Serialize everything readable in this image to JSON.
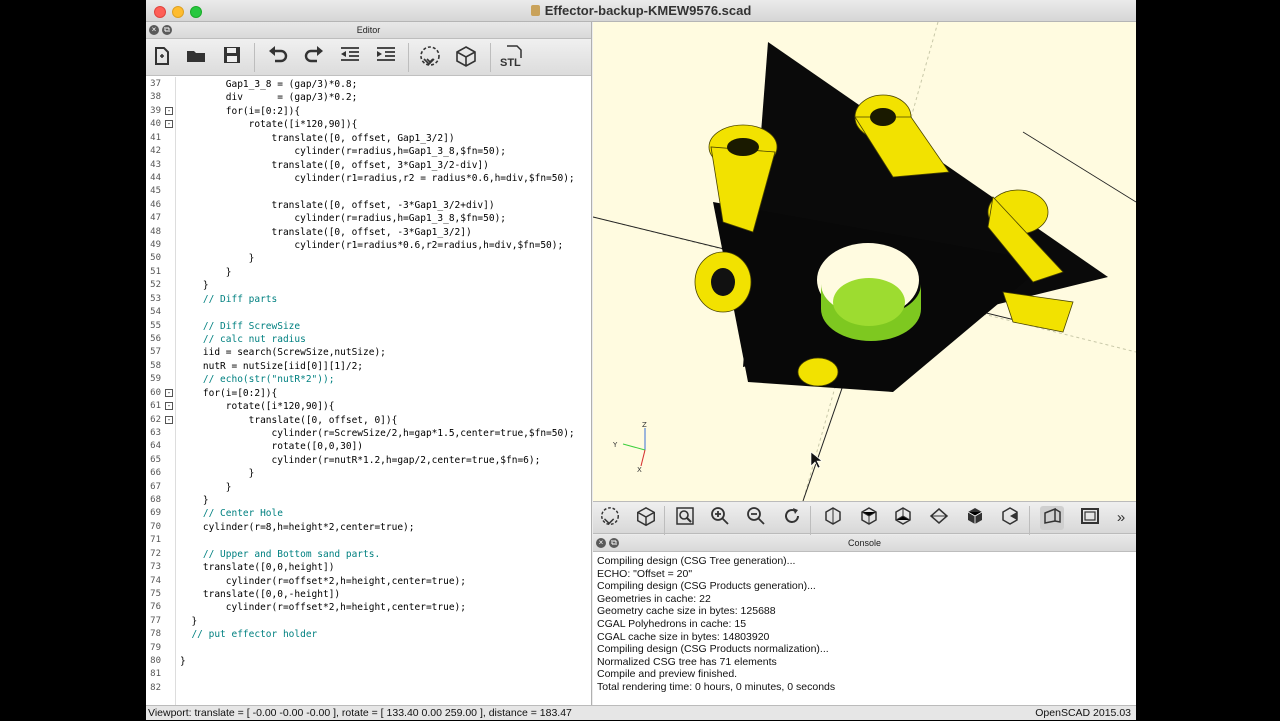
{
  "window": {
    "title": "Effector-backup-KMEW9576.scad"
  },
  "editor": {
    "header": "Editor",
    "toolbar": {
      "new": "new-file-icon",
      "open": "open-folder-icon",
      "save": "save-icon",
      "undo": "undo-icon",
      "redo": "redo-icon",
      "unindent": "unindent-icon",
      "indent": "indent-icon",
      "preview": "preview-icon",
      "render": "render-icon",
      "stl_label": "STL"
    },
    "lines": [
      {
        "n": "37",
        "fold": "",
        "text": "        Gap1_3_8 = (gap/3)*0.8;"
      },
      {
        "n": "38",
        "fold": "",
        "text": "        div      = (gap/3)*0.2;"
      },
      {
        "n": "39",
        "fold": "-",
        "text": "        for(i=[0:2]){"
      },
      {
        "n": "40",
        "fold": "-",
        "text": "            rotate([i*120,90]){"
      },
      {
        "n": "41",
        "fold": "",
        "text": "                translate([0, offset, Gap1_3/2])"
      },
      {
        "n": "42",
        "fold": "",
        "text": "                    cylinder(r=radius,h=Gap1_3_8,$fn=50);"
      },
      {
        "n": "43",
        "fold": "",
        "text": "                translate([0, offset, 3*Gap1_3/2-div])"
      },
      {
        "n": "44",
        "fold": "",
        "text": "                    cylinder(r1=radius,r2 = radius*0.6,h=div,$fn=50);"
      },
      {
        "n": "45",
        "fold": "",
        "text": ""
      },
      {
        "n": "46",
        "fold": "",
        "text": "                translate([0, offset, -3*Gap1_3/2+div])"
      },
      {
        "n": "47",
        "fold": "",
        "text": "                    cylinder(r=radius,h=Gap1_3_8,$fn=50);"
      },
      {
        "n": "48",
        "fold": "",
        "text": "                translate([0, offset, -3*Gap1_3/2])"
      },
      {
        "n": "49",
        "fold": "",
        "text": "                    cylinder(r1=radius*0.6,r2=radius,h=div,$fn=50);"
      },
      {
        "n": "50",
        "fold": "",
        "text": "            }"
      },
      {
        "n": "51",
        "fold": "",
        "text": "        }"
      },
      {
        "n": "52",
        "fold": "",
        "text": "    }"
      },
      {
        "n": "53",
        "fold": "",
        "text": "    // Diff parts"
      },
      {
        "n": "54",
        "fold": "",
        "text": ""
      },
      {
        "n": "55",
        "fold": "",
        "text": "    // Diff ScrewSize"
      },
      {
        "n": "56",
        "fold": "",
        "text": "    // calc nut radius"
      },
      {
        "n": "57",
        "fold": "",
        "text": "    iid = search(ScrewSize,nutSize);"
      },
      {
        "n": "58",
        "fold": "",
        "text": "    nutR = nutSize[iid[0]][1]/2;"
      },
      {
        "n": "59",
        "fold": "",
        "text": "    // echo(str(\"nutR*2\"));"
      },
      {
        "n": "60",
        "fold": "-",
        "text": "    for(i=[0:2]){"
      },
      {
        "n": "61",
        "fold": "-",
        "text": "        rotate([i*120,90]){"
      },
      {
        "n": "62",
        "fold": "-",
        "text": "            translate([0, offset, 0]){"
      },
      {
        "n": "63",
        "fold": "",
        "text": "                cylinder(r=ScrewSize/2,h=gap*1.5,center=true,$fn=50);"
      },
      {
        "n": "64",
        "fold": "",
        "text": "                rotate([0,0,30])"
      },
      {
        "n": "65",
        "fold": "",
        "text": "                cylinder(r=nutR*1.2,h=gap/2,center=true,$fn=6);"
      },
      {
        "n": "66",
        "fold": "",
        "text": "            }"
      },
      {
        "n": "67",
        "fold": "",
        "text": "        }"
      },
      {
        "n": "68",
        "fold": "",
        "text": "    }"
      },
      {
        "n": "69",
        "fold": "",
        "text": "    // Center Hole"
      },
      {
        "n": "70",
        "fold": "",
        "text": "    cylinder(r=8,h=height*2,center=true);"
      },
      {
        "n": "71",
        "fold": "",
        "text": ""
      },
      {
        "n": "72",
        "fold": "",
        "text": "    // Upper and Bottom sand parts."
      },
      {
        "n": "73",
        "fold": "",
        "text": "    translate([0,0,height])"
      },
      {
        "n": "74",
        "fold": "",
        "text": "        cylinder(r=offset*2,h=height,center=true);"
      },
      {
        "n": "75",
        "fold": "",
        "text": "    translate([0,0,-height])"
      },
      {
        "n": "76",
        "fold": "",
        "text": "        cylinder(r=offset*2,h=height,center=true);"
      },
      {
        "n": "77",
        "fold": "",
        "text": "  }"
      },
      {
        "n": "78",
        "fold": "",
        "text": "  // put effector holder"
      },
      {
        "n": "79",
        "fold": "",
        "text": ""
      },
      {
        "n": "80",
        "fold": "",
        "text": "}"
      },
      {
        "n": "81",
        "fold": "",
        "text": ""
      },
      {
        "n": "82",
        "fold": "",
        "text": ""
      }
    ]
  },
  "viewer": {
    "axis_labels": {
      "z": "Z",
      "y": "Y",
      "x": "X"
    },
    "toolbar": [
      "preview-icon",
      "render-icon",
      "view-all-icon",
      "zoom-in-icon",
      "zoom-out-icon",
      "reset-view-icon",
      "view-right-icon",
      "view-top-icon",
      "view-bottom-icon",
      "view-left-icon",
      "view-front-icon",
      "view-back-icon",
      "perspective-icon",
      "orthogonal-icon",
      "more-icon"
    ],
    "more_label": "»"
  },
  "console": {
    "header": "Console",
    "lines": [
      "Compiling design (CSG Tree generation)...",
      "ECHO: \"Offset = 20\"",
      "Compiling design (CSG Products generation)...",
      "Geometries in cache: 22",
      "Geometry cache size in bytes: 125688",
      "CGAL Polyhedrons in cache: 15",
      "CGAL cache size in bytes: 14803920",
      "Compiling design (CSG Products normalization)...",
      "Normalized CSG tree has 71 elements",
      "Compile and preview finished.",
      "Total rendering time: 0 hours, 0 minutes, 0 seconds"
    ]
  },
  "status": {
    "viewport": "Viewport: translate = [ -0.00 -0.00 -0.00 ], rotate = [ 133.40 0.00 259.00 ], distance = 183.47",
    "version": "OpenSCAD 2015.03"
  }
}
